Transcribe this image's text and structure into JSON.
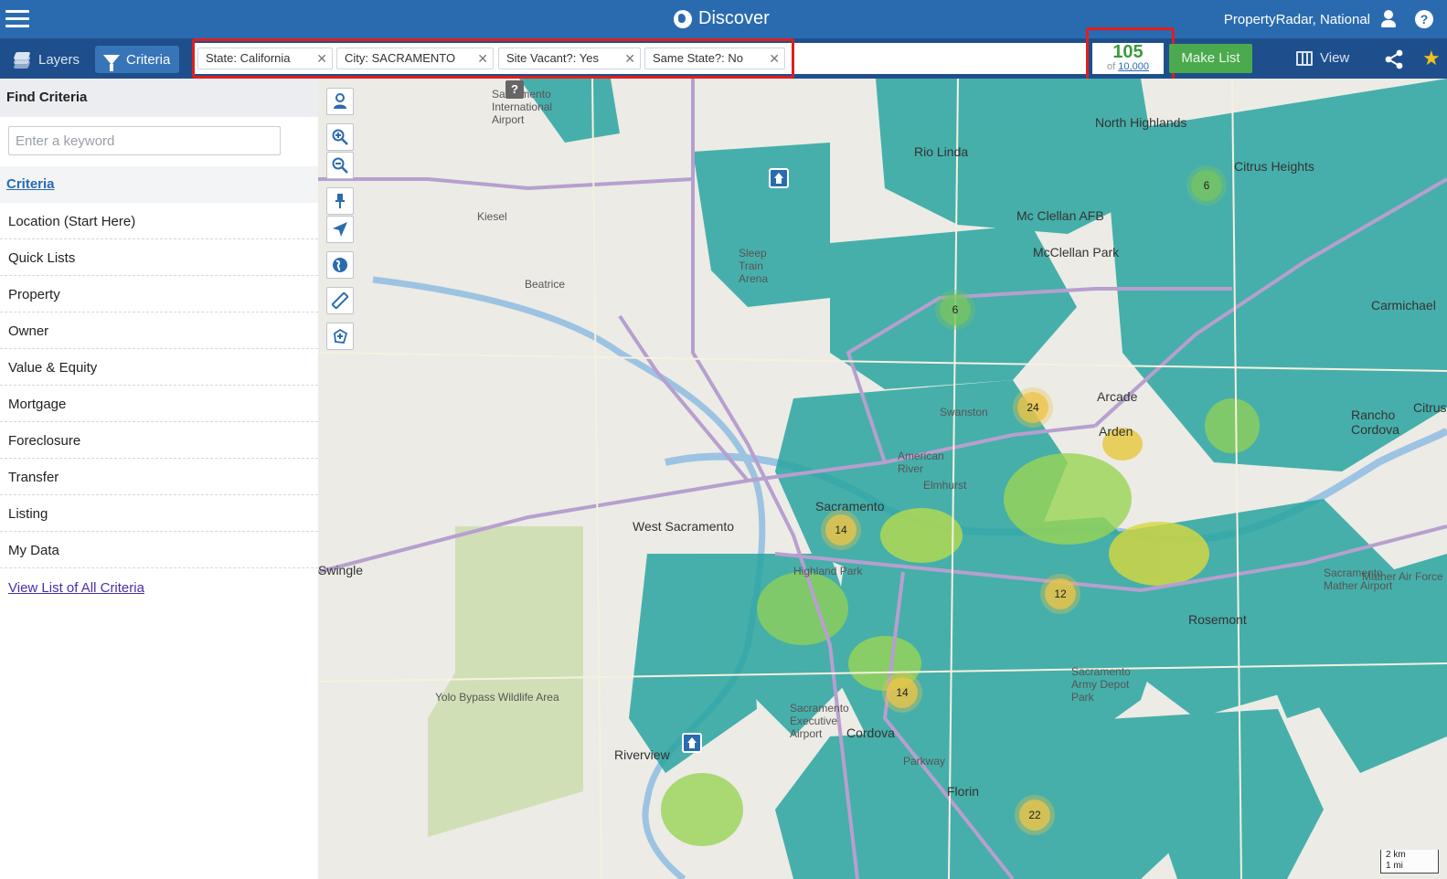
{
  "header": {
    "title": "Discover",
    "account": "PropertyRadar, National"
  },
  "toolbar": {
    "layers_label": "Layers",
    "criteria_label": "Criteria",
    "chips": [
      {
        "label": "State: California"
      },
      {
        "label": "City: SACRAMENTO"
      },
      {
        "label": "Site Vacant?: Yes"
      },
      {
        "label": "Same State?: No"
      }
    ],
    "count": "105",
    "count_of_prefix": "of",
    "count_total": "10,000",
    "make_list_label": "Make List",
    "view_label": "View"
  },
  "sidebar": {
    "header": "Find Criteria",
    "search_placeholder": "Enter a keyword",
    "criteria_link": "Criteria",
    "items": [
      "Location (Start Here)",
      "Quick Lists",
      "Property",
      "Owner",
      "Value & Equity",
      "Mortgage",
      "Foreclosure",
      "Transfer",
      "Listing",
      "My Data"
    ],
    "all_link": "View List of All Criteria"
  },
  "map": {
    "labels": [
      {
        "text": "North Highlands"
      },
      {
        "text": "Rio Linda"
      },
      {
        "text": "Citrus Heights"
      },
      {
        "text": "Mc Clellan AFB"
      },
      {
        "text": "McClellan Park"
      },
      {
        "text": "Kiesel"
      },
      {
        "text": "Beatrice"
      },
      {
        "text": "Sleep Train Arena"
      },
      {
        "text": "Arcade"
      },
      {
        "text": "Swanston"
      },
      {
        "text": "Arden"
      },
      {
        "text": "Carmichael"
      },
      {
        "text": "Rancho Cordova"
      },
      {
        "text": "American River"
      },
      {
        "text": "Sacramento"
      },
      {
        "text": "West Sacramento"
      },
      {
        "text": "Swingle"
      },
      {
        "text": "Highland Park"
      },
      {
        "text": "Sacramento Mather Airport"
      },
      {
        "text": "Rosemont"
      },
      {
        "text": "Yolo Bypass Wildlife Area"
      },
      {
        "text": "Sacramento Executive Airport"
      },
      {
        "text": "Cordova"
      },
      {
        "text": "Riverview"
      },
      {
        "text": "Florin"
      },
      {
        "text": "Sacramento Army Depot Park"
      },
      {
        "text": "Sacramento International Airport"
      },
      {
        "text": "Citrus"
      },
      {
        "text": "Mather Air Force"
      },
      {
        "text": "Parkway"
      },
      {
        "text": "Elmhurst"
      }
    ],
    "clusters": [
      "6",
      "6",
      "24",
      "14",
      "12",
      "14",
      "22"
    ],
    "scale_km": "2 km",
    "scale_mi": "1 mi"
  }
}
